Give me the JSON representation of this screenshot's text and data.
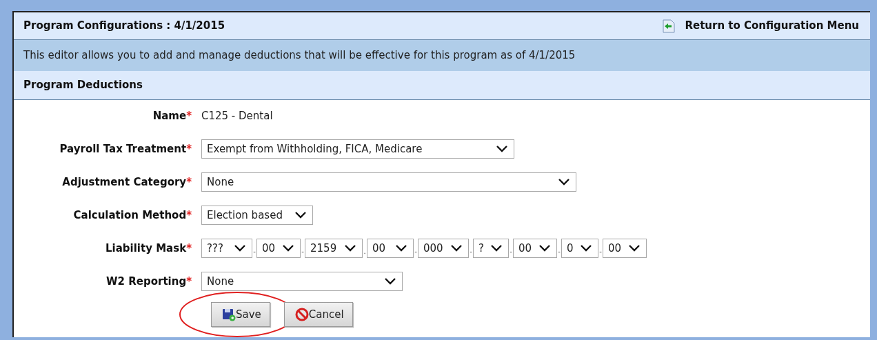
{
  "header": {
    "title": "Program Configurations : 4/1/2015",
    "return_link": "Return to Configuration Menu"
  },
  "description": "This editor allows you to add and manage deductions that will be effective for this program as of 4/1/2015",
  "section": {
    "title": "Program Deductions"
  },
  "fields": [
    {
      "kind": "text",
      "label": "Name",
      "required_mark": "*",
      "value": "C125 - Dental"
    },
    {
      "kind": "select",
      "label": "Payroll Tax Treatment",
      "required_mark": "*",
      "value": "Exempt from Withholding, FICA, Medicare"
    },
    {
      "kind": "select",
      "label": "Adjustment Category",
      "required_mark": "*",
      "value": "None"
    },
    {
      "kind": "select",
      "label": "Calculation Method",
      "required_mark": "*",
      "value": "Election based"
    },
    {
      "kind": "mask",
      "label": "Liability Mask",
      "required_mark": "*",
      "segments": [
        {
          "value": "???",
          "separator": "-"
        },
        {
          "value": "00",
          "separator": "-"
        },
        {
          "value": "2159",
          "separator": "."
        },
        {
          "value": "00",
          "separator": "-"
        },
        {
          "value": "000",
          "separator": "-"
        },
        {
          "value": "?",
          "separator": "-"
        },
        {
          "value": "00",
          "separator": "-"
        },
        {
          "value": "0",
          "separator": "-"
        },
        {
          "value": "00"
        }
      ]
    },
    {
      "kind": "select",
      "label": "W2 Reporting",
      "required_mark": "*",
      "value": "None"
    }
  ],
  "buttons": [
    {
      "kind": "save",
      "label": "Save",
      "highlighted": true
    },
    {
      "kind": "cancel",
      "label": "Cancel",
      "highlighted": false
    }
  ]
}
